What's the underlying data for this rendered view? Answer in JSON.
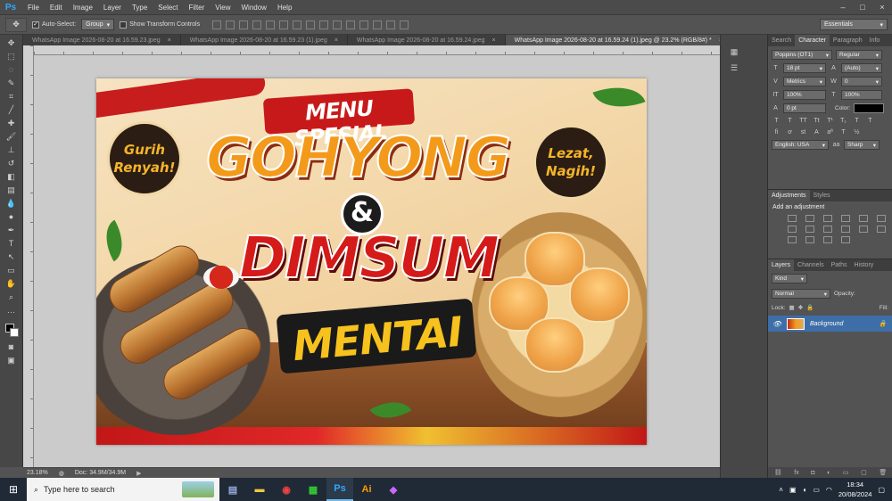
{
  "app": {
    "logo": "Ps"
  },
  "menu": [
    "File",
    "Edit",
    "Image",
    "Layer",
    "Type",
    "Select",
    "Filter",
    "View",
    "Window",
    "Help"
  ],
  "window_controls": [
    "–",
    "□",
    "×"
  ],
  "options": {
    "auto_select_label": "Auto-Select:",
    "auto_select_value": "Group",
    "transform_label": "Show Transform Controls",
    "workspace": "Essentials"
  },
  "tabs": [
    {
      "label": "WhatsApp Image 2026-08-20 at 16.59.23.jpeg",
      "active": false
    },
    {
      "label": "WhatsApp Image 2026-08-20 at 16.59.23 (1).jpeg",
      "active": false
    },
    {
      "label": "WhatsApp Image 2026-08-20 at 16.59.24.jpeg",
      "active": false
    },
    {
      "label": "WhatsApp Image 2026-08-20 at 16.59.24 (1).jpeg @ 23.2% (RGB/8#) *",
      "active": true
    }
  ],
  "artwork": {
    "menu_spesial": "MENU SPESIAL",
    "gohyong": "GOHYONG",
    "amp": "&",
    "dimsum": "DIMSUM",
    "mentai": "MENTAI",
    "badge_left_1": "Gurih",
    "badge_left_2": "Renyah!",
    "badge_right_1": "Lezat,",
    "badge_right_2": "Nagih!"
  },
  "status": {
    "zoom": "23.18%",
    "doc": "Doc: 34.9M/34.9M"
  },
  "character_panel": {
    "tabs": [
      "Search",
      "Character",
      "Paragraph",
      "Info"
    ],
    "font_family": "Poppins (OT1)",
    "font_style": "Regular",
    "size": "18 pt",
    "leading": "(Auto)",
    "kerning": "Metrics",
    "tracking": "0",
    "vscale": "100%",
    "hscale": "100%",
    "baseline": "0 pt",
    "color_label": "Color:",
    "language": "English: USA",
    "aa": "Sharp",
    "aa_icon": "aa"
  },
  "adjustments": {
    "tabs": [
      "Adjustments",
      "Styles"
    ],
    "title": "Add an adjustment"
  },
  "layers": {
    "tabs": [
      "Layers",
      "Channels",
      "Paths",
      "History"
    ],
    "kind": "Kind",
    "blend": "Normal",
    "opacity_label": "Opacity:",
    "lock_label": "Lock:",
    "fill_label": "Fill:",
    "layer_name": "Background"
  },
  "taskbar": {
    "search_placeholder": "Type here to search",
    "time": "18:34",
    "date": "20/08/2024"
  },
  "colors": {
    "accent": "#31a8ff",
    "selected_layer": "#3d6ea8",
    "taskbar": "#1f2a36"
  }
}
